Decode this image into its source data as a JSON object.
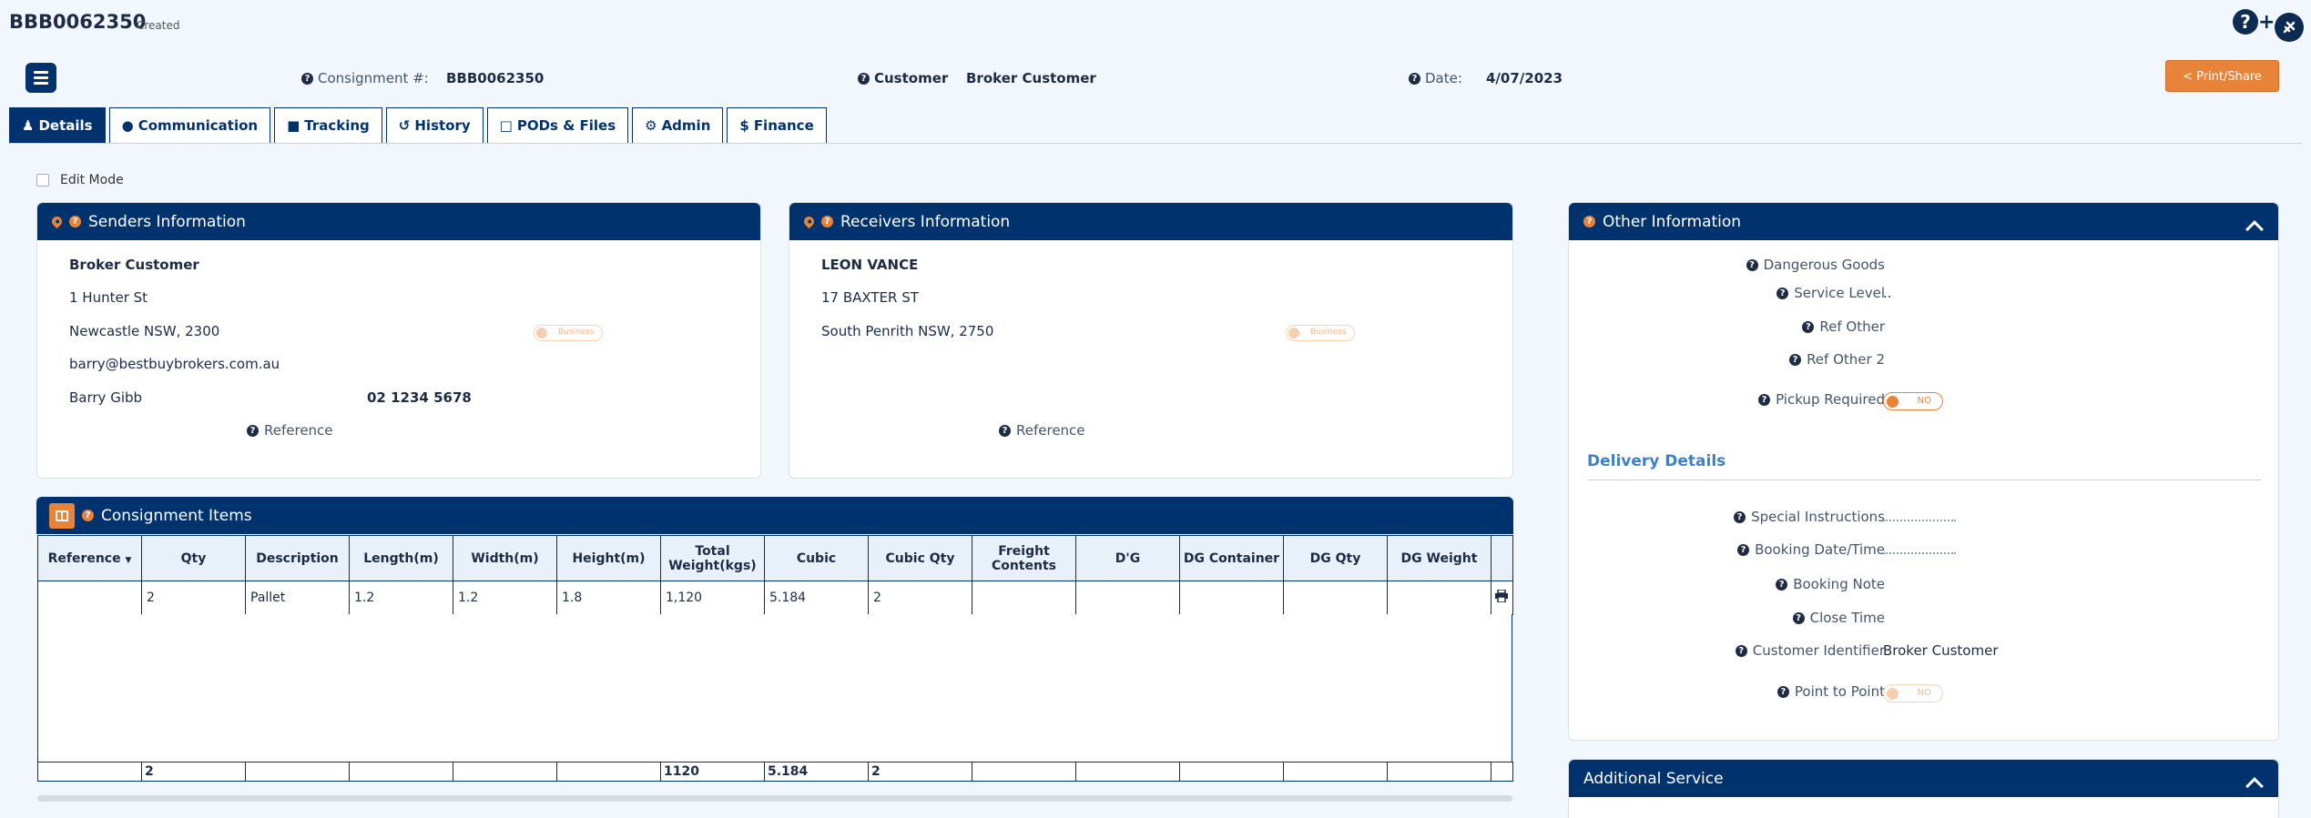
{
  "header": {
    "consignment_id": "BBB0062350",
    "status": "Created",
    "help_icon": "?",
    "plus_icon": "+"
  },
  "info_bar": {
    "consignment_label": "Consignment #:",
    "consignment_value": "BBB0062350",
    "customer_label": "Customer",
    "customer_value": "Broker Customer",
    "date_label": "Date:",
    "date_value": "4/07/2023",
    "print_label": "Print/Share"
  },
  "tabs": [
    {
      "label": "Details",
      "icon": "user-icon"
    },
    {
      "label": "Communication",
      "icon": "comment-icon"
    },
    {
      "label": "Tracking",
      "icon": "truck-icon"
    },
    {
      "label": "History",
      "icon": "history-icon"
    },
    {
      "label": "PODs & Files",
      "icon": "file-icon"
    },
    {
      "label": "Admin",
      "icon": "gear-icon"
    },
    {
      "label": "Finance",
      "icon": "dollar-icon"
    }
  ],
  "edit_mode_label": "Edit Mode",
  "senders": {
    "title": "Senders Information",
    "name": "Broker Customer",
    "street": "1 Hunter St",
    "city": "Newcastle NSW, 2300",
    "email": "barry@bestbuybrokers.com.au",
    "contact": "Barry Gibb",
    "phone": "02 1234 5678",
    "toggle_label": "Business",
    "reference_label": "Reference"
  },
  "receivers": {
    "title": "Receivers Information",
    "name": "LEON VANCE",
    "street": "17 BAXTER ST",
    "city": "South Penrith NSW, 2750",
    "toggle_label": "Business",
    "reference_label": "Reference"
  },
  "other_info": {
    "title": "Other Information",
    "dangerous_goods_label": "Dangerous Goods",
    "service_level_label": "Service Level",
    "service_level_value": "..",
    "ref_other_label": "Ref Other",
    "ref_other2_label": "Ref Other 2",
    "pickup_label": "Pickup Required",
    "pickup_value": "NO",
    "delivery_title": "Delivery Details",
    "special_instructions_label": "Special Instructions",
    "booking_datetime_label": "Booking Date/Time",
    "booking_note_label": "Booking Note",
    "close_time_label": "Close Time",
    "customer_identifier_label": "Customer Identifier",
    "customer_identifier_value": "Broker Customer",
    "point_to_point_label": "Point to Point",
    "point_to_point_value": "NO"
  },
  "additional_service": {
    "title": "Additional Service"
  },
  "items": {
    "title": "Consignment Items",
    "columns": [
      "Reference",
      "Qty",
      "Description",
      "Length(m)",
      "Width(m)",
      "Height(m)",
      "Total Weight(kgs)",
      "Cubic",
      "Cubic Qty",
      "Freight Contents",
      "D'G",
      "DG Container",
      "DG Qty",
      "DG Weight"
    ],
    "row": [
      "",
      "2",
      "Pallet",
      "1.2",
      "1.2",
      "1.8",
      "1,120",
      "5.184",
      "2",
      "",
      "",
      "",
      "",
      ""
    ],
    "totals": [
      "",
      "2",
      "",
      "",
      "",
      "",
      "1120",
      "5.184",
      "2",
      "",
      "",
      "",
      "",
      ""
    ]
  },
  "colors": {
    "navy": "#00336e",
    "orange": "#e8833a",
    "background": "#f2f7fd",
    "link_blue": "#3b82c4"
  }
}
